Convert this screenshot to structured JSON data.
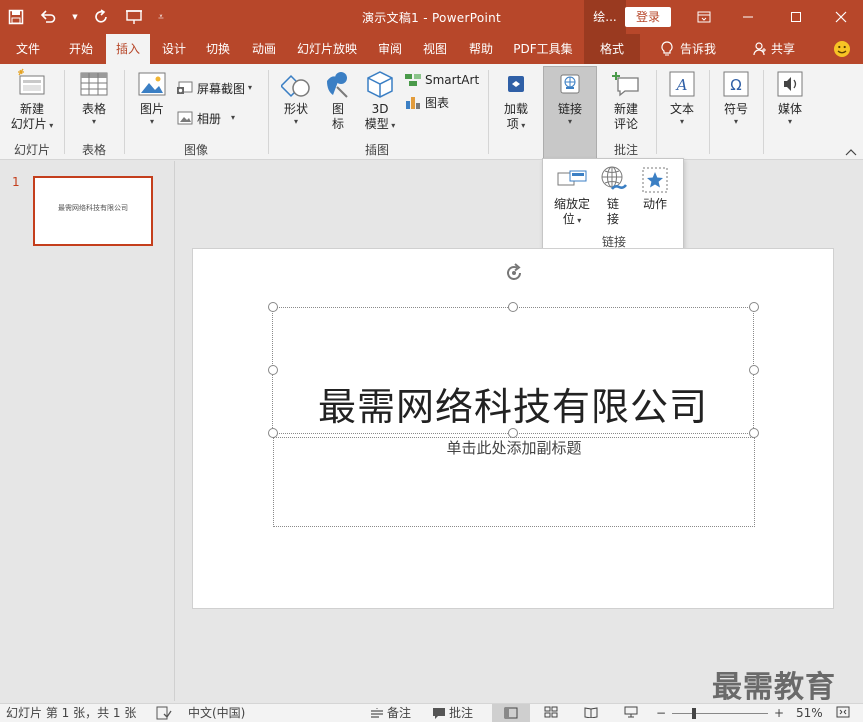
{
  "titlebar": {
    "doc_title": "演示文稿1  -  PowerPoint",
    "context_tab_title": "绘...",
    "login_label": "登录"
  },
  "tabs": [
    {
      "label": "文件"
    },
    {
      "label": "开始"
    },
    {
      "label": "插入"
    },
    {
      "label": "设计"
    },
    {
      "label": "切换"
    },
    {
      "label": "动画"
    },
    {
      "label": "幻灯片放映"
    },
    {
      "label": "审阅"
    },
    {
      "label": "视图"
    },
    {
      "label": "帮助"
    },
    {
      "label": "PDF工具集"
    },
    {
      "label": "格式"
    }
  ],
  "tell_me": "告诉我",
  "share": "共享",
  "ribbon": {
    "new_slide_1": "新建",
    "new_slide_2": "幻灯片",
    "table": "表格",
    "picture": "图片",
    "screenshot": "屏幕截图",
    "album": "相册",
    "shapes": "形状",
    "icons_1": "图",
    "icons_2": "标",
    "model3d_1": "3D",
    "model3d_2": "模型",
    "smartart": "SmartArt",
    "chart": "图表",
    "addins_1": "加载",
    "addins_2": "项",
    "links": "链接",
    "new_comment_1": "新建",
    "new_comment_2": "评论",
    "text": "文本",
    "symbols": "符号",
    "media": "媒体",
    "groups": {
      "slides": "幻灯片",
      "tables": "表格",
      "images": "图像",
      "illustrations": "插图",
      "comments": "批注"
    }
  },
  "links_dropdown": {
    "zoom_1": "缩放定",
    "zoom_2": "位",
    "link_1": "链",
    "link_2": "接",
    "action": "动作",
    "group": "链接"
  },
  "thumbnails": [
    {
      "number": "1",
      "text": "最需网络科技有限公司"
    }
  ],
  "slide": {
    "title": "最需网络科技有限公司",
    "subtitle_placeholder": "单击此处添加副标题"
  },
  "watermark": "最需教育",
  "status": {
    "slide_info": "幻灯片 第 1 张，共 1 张",
    "language": "中文(中国)",
    "notes": "备注",
    "comments": "批注",
    "zoom_percent": "51%",
    "zoom_value": 51
  },
  "colors": {
    "accent": "#b7472a",
    "context_tab": "#9a3a20",
    "thumb_border": "#c43e1c"
  }
}
